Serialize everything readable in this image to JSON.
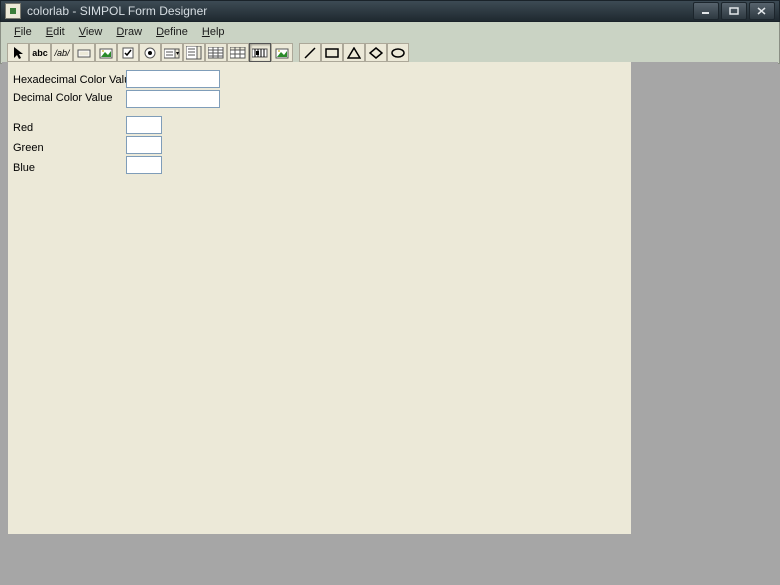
{
  "window": {
    "title": "colorlab - SIMPOL Form Designer"
  },
  "menu": {
    "file": "File",
    "edit": "Edit",
    "view": "View",
    "draw": "Draw",
    "define": "Define",
    "help": "Help"
  },
  "form": {
    "hex_label": "Hexadecimal Color Value",
    "dec_label": "Decimal Color Value",
    "red_label": "Red",
    "green_label": "Green",
    "blue_label": "Blue",
    "hex_value": "",
    "dec_value": "",
    "red_value": "",
    "green_value": "",
    "blue_value": ""
  },
  "icons": {
    "pointer": "pointer",
    "text": "abc",
    "edit": "/ab/",
    "button": "button",
    "image": "image",
    "checkbox": "checkbox",
    "radio": "radio",
    "combo": "combo",
    "listbox": "listbox",
    "grid": "grid",
    "table": "table",
    "gauge": "gauge",
    "image2": "image2",
    "line": "line",
    "hline": "hline",
    "triangle": "triangle",
    "diamond": "diamond",
    "ellipse": "ellipse"
  }
}
